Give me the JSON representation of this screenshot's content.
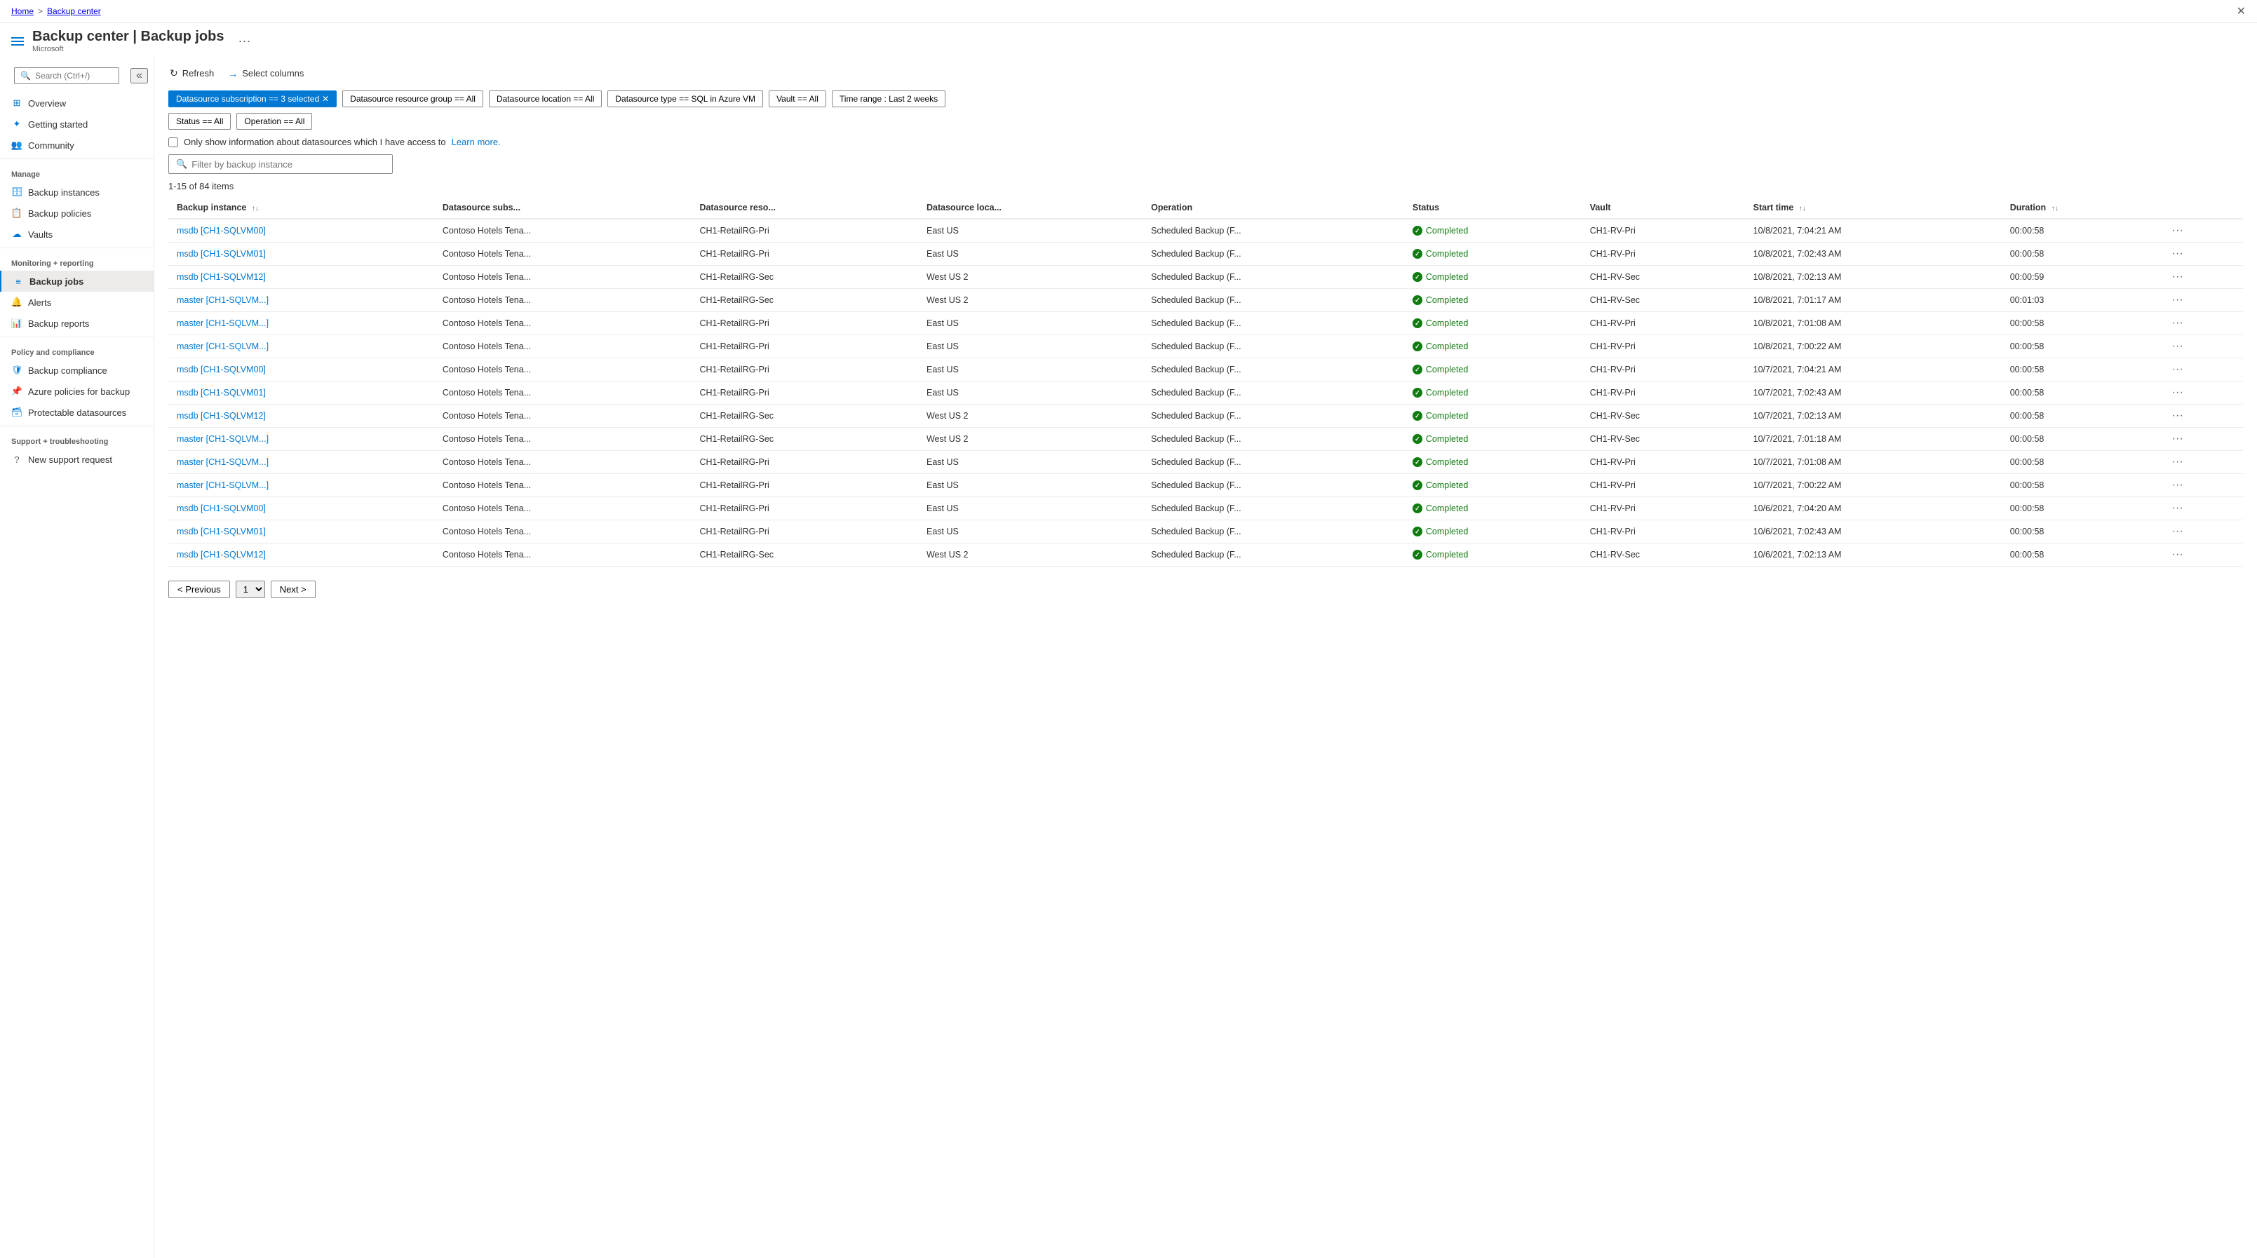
{
  "breadcrumb": {
    "home": "Home",
    "separator": ">",
    "current": "Backup center"
  },
  "header": {
    "title": "Backup center | Backup jobs",
    "subtitle": "Microsoft",
    "more_label": "···"
  },
  "sidebar": {
    "search_placeholder": "Search (Ctrl+/)",
    "collapse_tooltip": "Collapse",
    "nav_items": [
      {
        "id": "overview",
        "label": "Overview",
        "icon": "grid"
      },
      {
        "id": "getting-started",
        "label": "Getting started",
        "icon": "star"
      },
      {
        "id": "community",
        "label": "Community",
        "icon": "people"
      }
    ],
    "sections": [
      {
        "title": "Manage",
        "items": [
          {
            "id": "backup-instances",
            "label": "Backup instances",
            "icon": "instances"
          },
          {
            "id": "backup-policies",
            "label": "Backup policies",
            "icon": "policy"
          },
          {
            "id": "vaults",
            "label": "Vaults",
            "icon": "vault"
          }
        ]
      },
      {
        "title": "Monitoring + reporting",
        "items": [
          {
            "id": "backup-jobs",
            "label": "Backup jobs",
            "icon": "jobs",
            "active": true
          },
          {
            "id": "alerts",
            "label": "Alerts",
            "icon": "alert"
          },
          {
            "id": "backup-reports",
            "label": "Backup reports",
            "icon": "reports"
          }
        ]
      },
      {
        "title": "Policy and compliance",
        "items": [
          {
            "id": "backup-compliance",
            "label": "Backup compliance",
            "icon": "compliance"
          },
          {
            "id": "azure-policies",
            "label": "Azure policies for backup",
            "icon": "azure-policy"
          },
          {
            "id": "protectable-datasources",
            "label": "Protectable datasources",
            "icon": "datasource"
          }
        ]
      },
      {
        "title": "Support + troubleshooting",
        "items": [
          {
            "id": "new-support",
            "label": "New support request",
            "icon": "support"
          }
        ]
      }
    ]
  },
  "toolbar": {
    "refresh_label": "Refresh",
    "select_columns_label": "Select columns"
  },
  "filters": {
    "chips": [
      {
        "id": "datasource-subscription",
        "label": "Datasource subscription == 3 selected",
        "active": true
      },
      {
        "id": "datasource-resource-group",
        "label": "Datasource resource group == All",
        "active": false
      },
      {
        "id": "datasource-location",
        "label": "Datasource location == All",
        "active": false
      },
      {
        "id": "datasource-type",
        "label": "Datasource type == SQL in Azure VM",
        "active": false
      },
      {
        "id": "vault",
        "label": "Vault == All",
        "active": false
      },
      {
        "id": "time-range",
        "label": "Time range : Last 2 weeks",
        "active": false
      },
      {
        "id": "status",
        "label": "Status == All",
        "active": false
      },
      {
        "id": "operation",
        "label": "Operation == All",
        "active": false
      }
    ],
    "checkbox_label": "Only show information about datasources which I have access to",
    "learn_more": "Learn more.",
    "search_placeholder": "Filter by backup instance",
    "items_count": "1-15 of 84 items"
  },
  "table": {
    "columns": [
      {
        "id": "backup-instance",
        "label": "Backup instance",
        "sortable": true
      },
      {
        "id": "datasource-subs",
        "label": "Datasource subs...",
        "sortable": false
      },
      {
        "id": "datasource-reso",
        "label": "Datasource reso...",
        "sortable": false
      },
      {
        "id": "datasource-loca",
        "label": "Datasource loca...",
        "sortable": false
      },
      {
        "id": "operation",
        "label": "Operation",
        "sortable": false
      },
      {
        "id": "status",
        "label": "Status",
        "sortable": false
      },
      {
        "id": "vault",
        "label": "Vault",
        "sortable": false
      },
      {
        "id": "start-time",
        "label": "Start time",
        "sortable": true
      },
      {
        "id": "duration",
        "label": "Duration",
        "sortable": true
      }
    ],
    "rows": [
      {
        "backup_instance": "msdb [CH1-SQLVM00]",
        "datasource_subs": "Contoso Hotels Tena...",
        "datasource_reso": "CH1-RetailRG-Pri",
        "datasource_loca": "East US",
        "operation": "Scheduled Backup (F...",
        "status": "Completed",
        "vault": "CH1-RV-Pri",
        "start_time": "10/8/2021, 7:04:21 AM",
        "duration": "00:00:58"
      },
      {
        "backup_instance": "msdb [CH1-SQLVM01]",
        "datasource_subs": "Contoso Hotels Tena...",
        "datasource_reso": "CH1-RetailRG-Pri",
        "datasource_loca": "East US",
        "operation": "Scheduled Backup (F...",
        "status": "Completed",
        "vault": "CH1-RV-Pri",
        "start_time": "10/8/2021, 7:02:43 AM",
        "duration": "00:00:58"
      },
      {
        "backup_instance": "msdb [CH1-SQLVM12]",
        "datasource_subs": "Contoso Hotels Tena...",
        "datasource_reso": "CH1-RetailRG-Sec",
        "datasource_loca": "West US 2",
        "operation": "Scheduled Backup (F...",
        "status": "Completed",
        "vault": "CH1-RV-Sec",
        "start_time": "10/8/2021, 7:02:13 AM",
        "duration": "00:00:59"
      },
      {
        "backup_instance": "master [CH1-SQLVM...]",
        "datasource_subs": "Contoso Hotels Tena...",
        "datasource_reso": "CH1-RetailRG-Sec",
        "datasource_loca": "West US 2",
        "operation": "Scheduled Backup (F...",
        "status": "Completed",
        "vault": "CH1-RV-Sec",
        "start_time": "10/8/2021, 7:01:17 AM",
        "duration": "00:01:03"
      },
      {
        "backup_instance": "master [CH1-SQLVM...]",
        "datasource_subs": "Contoso Hotels Tena...",
        "datasource_reso": "CH1-RetailRG-Pri",
        "datasource_loca": "East US",
        "operation": "Scheduled Backup (F...",
        "status": "Completed",
        "vault": "CH1-RV-Pri",
        "start_time": "10/8/2021, 7:01:08 AM",
        "duration": "00:00:58"
      },
      {
        "backup_instance": "master [CH1-SQLVM...]",
        "datasource_subs": "Contoso Hotels Tena...",
        "datasource_reso": "CH1-RetailRG-Pri",
        "datasource_loca": "East US",
        "operation": "Scheduled Backup (F...",
        "status": "Completed",
        "vault": "CH1-RV-Pri",
        "start_time": "10/8/2021, 7:00:22 AM",
        "duration": "00:00:58"
      },
      {
        "backup_instance": "msdb [CH1-SQLVM00]",
        "datasource_subs": "Contoso Hotels Tena...",
        "datasource_reso": "CH1-RetailRG-Pri",
        "datasource_loca": "East US",
        "operation": "Scheduled Backup (F...",
        "status": "Completed",
        "vault": "CH1-RV-Pri",
        "start_time": "10/7/2021, 7:04:21 AM",
        "duration": "00:00:58"
      },
      {
        "backup_instance": "msdb [CH1-SQLVM01]",
        "datasource_subs": "Contoso Hotels Tena...",
        "datasource_reso": "CH1-RetailRG-Pri",
        "datasource_loca": "East US",
        "operation": "Scheduled Backup (F...",
        "status": "Completed",
        "vault": "CH1-RV-Pri",
        "start_time": "10/7/2021, 7:02:43 AM",
        "duration": "00:00:58"
      },
      {
        "backup_instance": "msdb [CH1-SQLVM12]",
        "datasource_subs": "Contoso Hotels Tena...",
        "datasource_reso": "CH1-RetailRG-Sec",
        "datasource_loca": "West US 2",
        "operation": "Scheduled Backup (F...",
        "status": "Completed",
        "vault": "CH1-RV-Sec",
        "start_time": "10/7/2021, 7:02:13 AM",
        "duration": "00:00:58"
      },
      {
        "backup_instance": "master [CH1-SQLVM...]",
        "datasource_subs": "Contoso Hotels Tena...",
        "datasource_reso": "CH1-RetailRG-Sec",
        "datasource_loca": "West US 2",
        "operation": "Scheduled Backup (F...",
        "status": "Completed",
        "vault": "CH1-RV-Sec",
        "start_time": "10/7/2021, 7:01:18 AM",
        "duration": "00:00:58"
      },
      {
        "backup_instance": "master [CH1-SQLVM...]",
        "datasource_subs": "Contoso Hotels Tena...",
        "datasource_reso": "CH1-RetailRG-Pri",
        "datasource_loca": "East US",
        "operation": "Scheduled Backup (F...",
        "status": "Completed",
        "vault": "CH1-RV-Pri",
        "start_time": "10/7/2021, 7:01:08 AM",
        "duration": "00:00:58"
      },
      {
        "backup_instance": "master [CH1-SQLVM...]",
        "datasource_subs": "Contoso Hotels Tena...",
        "datasource_reso": "CH1-RetailRG-Pri",
        "datasource_loca": "East US",
        "operation": "Scheduled Backup (F...",
        "status": "Completed",
        "vault": "CH1-RV-Pri",
        "start_time": "10/7/2021, 7:00:22 AM",
        "duration": "00:00:58"
      },
      {
        "backup_instance": "msdb [CH1-SQLVM00]",
        "datasource_subs": "Contoso Hotels Tena...",
        "datasource_reso": "CH1-RetailRG-Pri",
        "datasource_loca": "East US",
        "operation": "Scheduled Backup (F...",
        "status": "Completed",
        "vault": "CH1-RV-Pri",
        "start_time": "10/6/2021, 7:04:20 AM",
        "duration": "00:00:58"
      },
      {
        "backup_instance": "msdb [CH1-SQLVM01]",
        "datasource_subs": "Contoso Hotels Tena...",
        "datasource_reso": "CH1-RetailRG-Pri",
        "datasource_loca": "East US",
        "operation": "Scheduled Backup (F...",
        "status": "Completed",
        "vault": "CH1-RV-Pri",
        "start_time": "10/6/2021, 7:02:43 AM",
        "duration": "00:00:58"
      },
      {
        "backup_instance": "msdb [CH1-SQLVM12]",
        "datasource_subs": "Contoso Hotels Tena...",
        "datasource_reso": "CH1-RetailRG-Sec",
        "datasource_loca": "West US 2",
        "operation": "Scheduled Backup (F...",
        "status": "Completed",
        "vault": "CH1-RV-Sec",
        "start_time": "10/6/2021, 7:02:13 AM",
        "duration": "00:00:58"
      }
    ]
  },
  "pagination": {
    "previous_label": "< Previous",
    "next_label": "Next >",
    "page_value": "1"
  }
}
